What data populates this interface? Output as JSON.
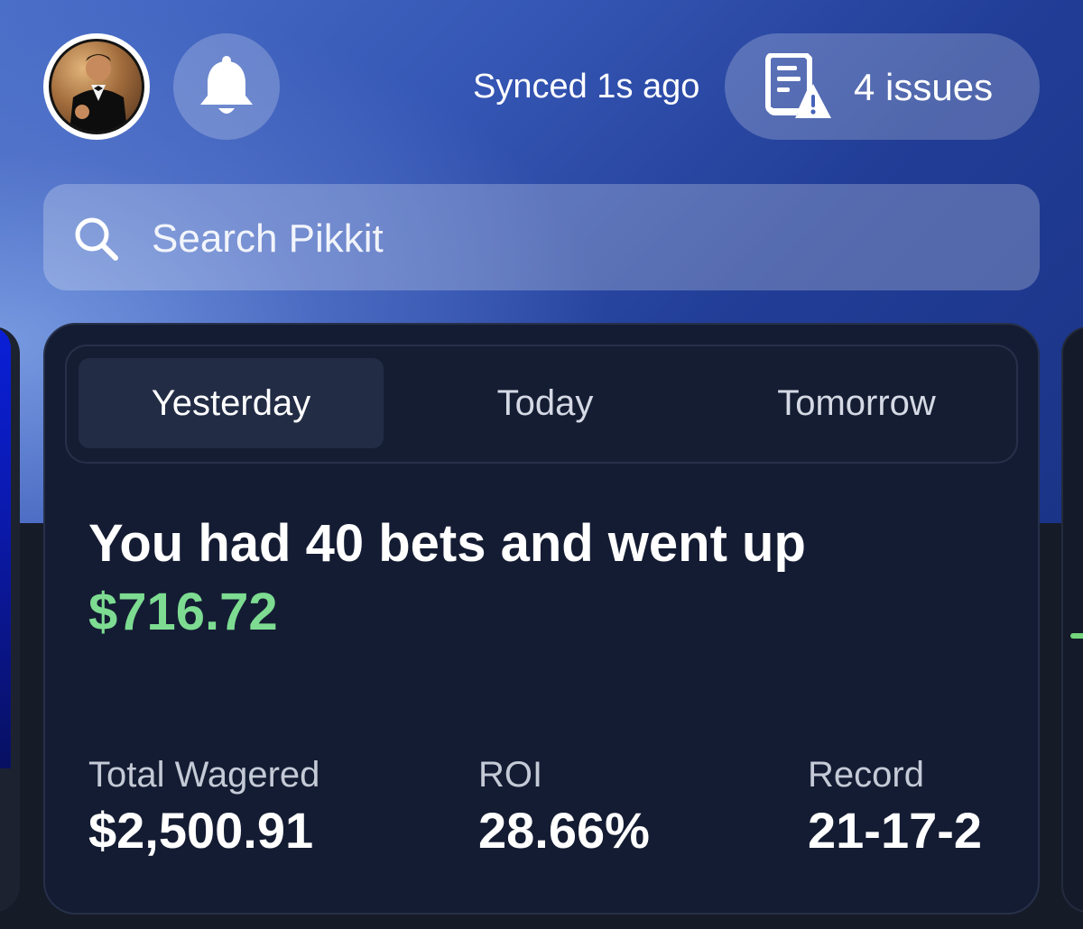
{
  "header": {
    "synced_text": "Synced 1s ago",
    "issues_label": "4 issues"
  },
  "search": {
    "placeholder": "Search Pikkit"
  },
  "summary_card": {
    "tabs": [
      {
        "label": "Yesterday",
        "active": true
      },
      {
        "label": "Today",
        "active": false
      },
      {
        "label": "Tomorrow",
        "active": false
      }
    ],
    "headline": "You had 40 bets and went up",
    "amount": "$716.72",
    "stats": [
      {
        "label": "Total Wagered",
        "value": "$2,500.91"
      },
      {
        "label": "ROI",
        "value": "28.66%"
      },
      {
        "label": "Record",
        "value": "21-17-2"
      }
    ]
  },
  "icons": {
    "avatar": "profile-photo",
    "bell": "bell-icon",
    "issues": "document-warning-icon",
    "search": "search-icon"
  },
  "colors": {
    "accent_green": "#7ddc92",
    "card_background": "#141c33",
    "gradient_blue": "#213d96"
  }
}
